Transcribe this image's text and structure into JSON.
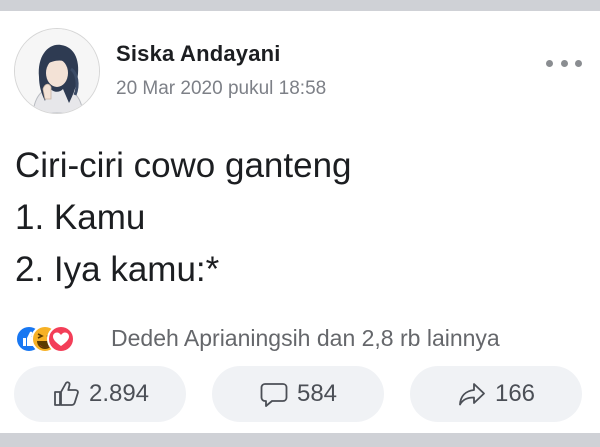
{
  "post": {
    "author": "Siska Andayani",
    "timestamp": "20 Mar 2020 pukul 18:58",
    "lines": [
      "Ciri-ciri cowo ganteng",
      "1. Kamu",
      "2. Iya kamu:*"
    ]
  },
  "reactions": {
    "icons": [
      "like-icon",
      "haha-icon",
      "love-icon"
    ],
    "summary": "Dedeh Aprianingsih dan 2,8 rb lainnya"
  },
  "actions": {
    "like_count": "2.894",
    "comment_count": "584",
    "share_count": "166"
  },
  "colors": {
    "like_blue": "#1877f2",
    "love_red": "#f33e58",
    "haha_yellow": "#f7b125",
    "text": "#1c1e21",
    "muted": "#65676b"
  }
}
